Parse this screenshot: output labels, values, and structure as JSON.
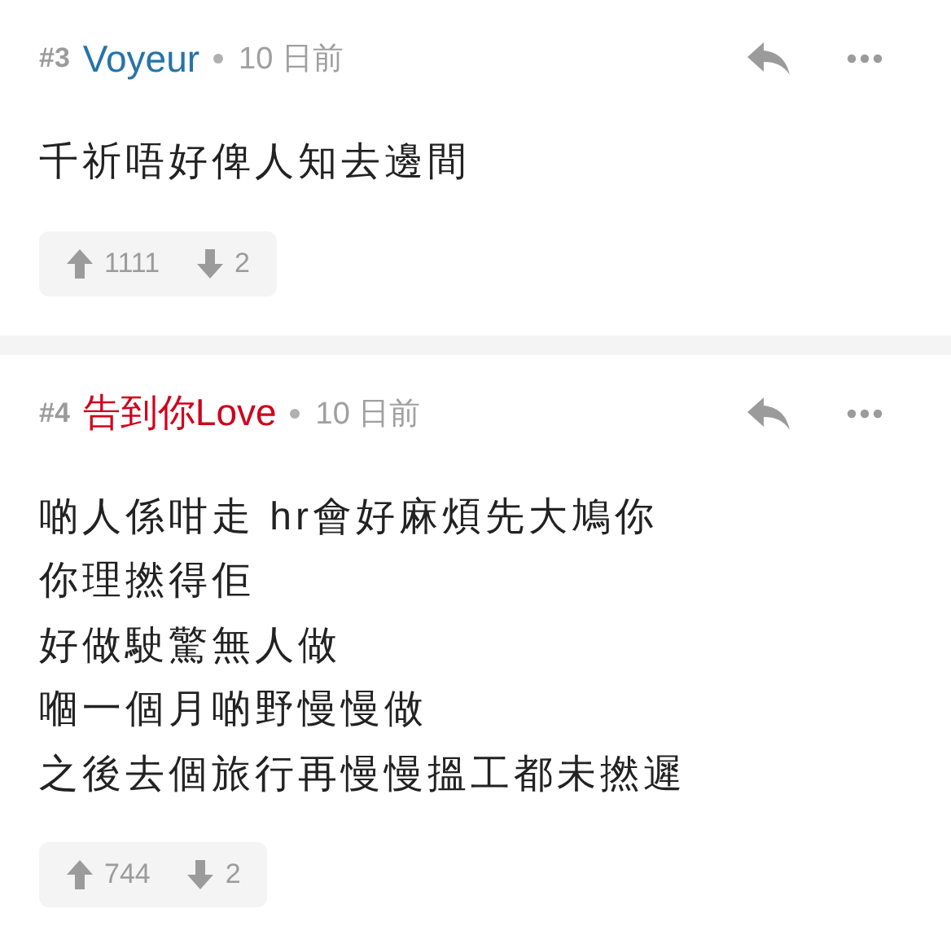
{
  "comments": [
    {
      "number": "#3",
      "author": "Voyeur",
      "color": "#2574a9",
      "time": "10 日前",
      "lines": [
        "千祈唔好俾人知去邊間"
      ],
      "upvotes": "1111",
      "downvotes": "2"
    },
    {
      "number": "#4",
      "author": "告到你Love",
      "color": "#d0021b",
      "time": "10 日前",
      "lines": [
        "啲人係咁走 hr會好麻煩先大鳩你",
        "你理撚得佢",
        "好做駛驚無人做",
        "嗰一個月啲野慢慢做",
        "之後去個旅行再慢慢搵工都未撚遲"
      ],
      "upvotes": "744",
      "downvotes": "2"
    }
  ]
}
